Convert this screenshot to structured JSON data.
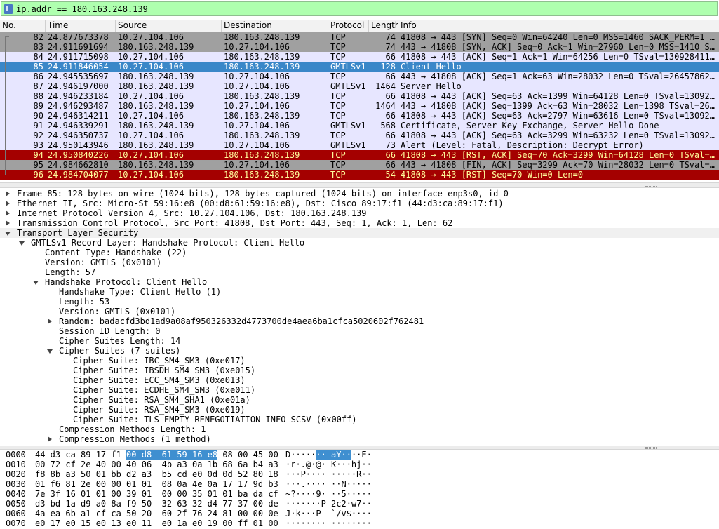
{
  "filter": {
    "value": "ip.addr == 180.163.248.139"
  },
  "columns": [
    "No.",
    "Time",
    "Source",
    "Destination",
    "Protocol",
    "Length",
    "Info"
  ],
  "packets": [
    {
      "no": "82",
      "time": "24.877673378",
      "src": "10.27.104.106",
      "dst": "180.163.248.139",
      "proto": "TCP",
      "len": "74",
      "info": "41808 → 443 [SYN] Seq=0 Win=64240 Len=0 MSS=1460 SACK_PERM=1 …",
      "bg": "#a0a0a0",
      "fg": "#000000"
    },
    {
      "no": "83",
      "time": "24.911691694",
      "src": "180.163.248.139",
      "dst": "10.27.104.106",
      "proto": "TCP",
      "len": "74",
      "info": "443 → 41808 [SYN, ACK] Seq=0 Ack=1 Win=27960 Len=0 MSS=1410 S…",
      "bg": "#a0a0a0",
      "fg": "#000000"
    },
    {
      "no": "84",
      "time": "24.911715098",
      "src": "10.27.104.106",
      "dst": "180.163.248.139",
      "proto": "TCP",
      "len": "66",
      "info": "41808 → 443 [ACK] Seq=1 Ack=1 Win=64256 Len=0 TSval=130928411…",
      "bg": "#e7e6ff",
      "fg": "#000000"
    },
    {
      "no": "85",
      "time": "24.911846054",
      "src": "10.27.104.106",
      "dst": "180.163.248.139",
      "proto": "GMTLSv1",
      "len": "128",
      "info": "Client Hello",
      "bg": "#3a87c8",
      "fg": "#ffffff"
    },
    {
      "no": "86",
      "time": "24.945535697",
      "src": "180.163.248.139",
      "dst": "10.27.104.106",
      "proto": "TCP",
      "len": "66",
      "info": "443 → 41808 [ACK] Seq=1 Ack=63 Win=28032 Len=0 TSval=26457862…",
      "bg": "#e7e6ff",
      "fg": "#000000"
    },
    {
      "no": "87",
      "time": "24.946197000",
      "src": "180.163.248.139",
      "dst": "10.27.104.106",
      "proto": "GMTLSv1",
      "len": "1464",
      "info": "Server Hello",
      "bg": "#e7e6ff",
      "fg": "#000000"
    },
    {
      "no": "88",
      "time": "24.946233184",
      "src": "10.27.104.106",
      "dst": "180.163.248.139",
      "proto": "TCP",
      "len": "66",
      "info": "41808 → 443 [ACK] Seq=63 Ack=1399 Win=64128 Len=0 TSval=13092…",
      "bg": "#e7e6ff",
      "fg": "#000000"
    },
    {
      "no": "89",
      "time": "24.946293487",
      "src": "180.163.248.139",
      "dst": "10.27.104.106",
      "proto": "TCP",
      "len": "1464",
      "info": "443 → 41808 [ACK] Seq=1399 Ack=63 Win=28032 Len=1398 TSval=26…",
      "bg": "#e7e6ff",
      "fg": "#000000"
    },
    {
      "no": "90",
      "time": "24.946314211",
      "src": "10.27.104.106",
      "dst": "180.163.248.139",
      "proto": "TCP",
      "len": "66",
      "info": "41808 → 443 [ACK] Seq=63 Ack=2797 Win=63616 Len=0 TSval=13092…",
      "bg": "#e7e6ff",
      "fg": "#000000"
    },
    {
      "no": "91",
      "time": "24.946339291",
      "src": "180.163.248.139",
      "dst": "10.27.104.106",
      "proto": "GMTLSv1",
      "len": "568",
      "info": "Certificate, Server Key Exchange, Server Hello Done",
      "bg": "#e7e6ff",
      "fg": "#000000"
    },
    {
      "no": "92",
      "time": "24.946350737",
      "src": "10.27.104.106",
      "dst": "180.163.248.139",
      "proto": "TCP",
      "len": "66",
      "info": "41808 → 443 [ACK] Seq=63 Ack=3299 Win=63232 Len=0 TSval=13092…",
      "bg": "#e7e6ff",
      "fg": "#000000"
    },
    {
      "no": "93",
      "time": "24.950143946",
      "src": "180.163.248.139",
      "dst": "10.27.104.106",
      "proto": "GMTLSv1",
      "len": "73",
      "info": "Alert (Level: Fatal, Description: Decrypt Error)",
      "bg": "#e7e6ff",
      "fg": "#000000"
    },
    {
      "no": "94",
      "time": "24.950840226",
      "src": "10.27.104.106",
      "dst": "180.163.248.139",
      "proto": "TCP",
      "len": "66",
      "info": "41808 → 443 [RST, ACK] Seq=70 Ack=3299 Win=64128 Len=0 TSval=…",
      "bg": "#a40000",
      "fg": "#fffc9c"
    },
    {
      "no": "95",
      "time": "24.984662810",
      "src": "180.163.248.139",
      "dst": "10.27.104.106",
      "proto": "TCP",
      "len": "66",
      "info": "443 → 41808 [FIN, ACK] Seq=3299 Ack=70 Win=28032 Len=0 TSval=…",
      "bg": "#a0a0a0",
      "fg": "#000000"
    },
    {
      "no": "96",
      "time": "24.984704077",
      "src": "10.27.104.106",
      "dst": "180.163.248.139",
      "proto": "TCP",
      "len": "54",
      "info": "41808 → 443 [RST] Seq=70 Win=0 Len=0",
      "bg": "#a40000",
      "fg": "#fffc9c"
    }
  ],
  "details": [
    {
      "indent": 0,
      "toggle": "collapsed",
      "text": "Frame 85: 128 bytes on wire (1024 bits), 128 bytes captured (1024 bits) on interface enp3s0, id 0"
    },
    {
      "indent": 0,
      "toggle": "collapsed",
      "text": "Ethernet II, Src: Micro-St_59:16:e8 (00:d8:61:59:16:e8), Dst: Cisco_89:17:f1 (44:d3:ca:89:17:f1)"
    },
    {
      "indent": 0,
      "toggle": "collapsed",
      "text": "Internet Protocol Version 4, Src: 10.27.104.106, Dst: 180.163.248.139"
    },
    {
      "indent": 0,
      "toggle": "collapsed",
      "text": "Transmission Control Protocol, Src Port: 41808, Dst Port: 443, Seq: 1, Ack: 1, Len: 62"
    },
    {
      "indent": 0,
      "toggle": "expanded",
      "text": "Transport Layer Security",
      "shaded": true
    },
    {
      "indent": 1,
      "toggle": "expanded",
      "text": "GMTLSv1 Record Layer: Handshake Protocol: Client Hello"
    },
    {
      "indent": 2,
      "toggle": "none",
      "text": "Content Type: Handshake (22)"
    },
    {
      "indent": 2,
      "toggle": "none",
      "text": "Version: GMTLS (0x0101)"
    },
    {
      "indent": 2,
      "toggle": "none",
      "text": "Length: 57"
    },
    {
      "indent": 2,
      "toggle": "expanded",
      "text": "Handshake Protocol: Client Hello"
    },
    {
      "indent": 3,
      "toggle": "none",
      "text": "Handshake Type: Client Hello (1)"
    },
    {
      "indent": 3,
      "toggle": "none",
      "text": "Length: 53"
    },
    {
      "indent": 3,
      "toggle": "none",
      "text": "Version: GMTLS (0x0101)"
    },
    {
      "indent": 3,
      "toggle": "collapsed",
      "text": "Random: badacfd3bd1ad9a08af950326332d4773700de4aea6ba1cfca5020602f762481"
    },
    {
      "indent": 3,
      "toggle": "none",
      "text": "Session ID Length: 0"
    },
    {
      "indent": 3,
      "toggle": "none",
      "text": "Cipher Suites Length: 14"
    },
    {
      "indent": 3,
      "toggle": "expanded",
      "text": "Cipher Suites (7 suites)"
    },
    {
      "indent": 4,
      "toggle": "none",
      "text": "Cipher Suite: IBC_SM4_SM3 (0xe017)"
    },
    {
      "indent": 4,
      "toggle": "none",
      "text": "Cipher Suite: IBSDH_SM4_SM3 (0xe015)"
    },
    {
      "indent": 4,
      "toggle": "none",
      "text": "Cipher Suite: ECC_SM4_SM3 (0xe013)"
    },
    {
      "indent": 4,
      "toggle": "none",
      "text": "Cipher Suite: ECDHE_SM4_SM3 (0xe011)"
    },
    {
      "indent": 4,
      "toggle": "none",
      "text": "Cipher Suite: RSA_SM4_SHA1 (0xe01a)"
    },
    {
      "indent": 4,
      "toggle": "none",
      "text": "Cipher Suite: RSA_SM4_SM3 (0xe019)"
    },
    {
      "indent": 4,
      "toggle": "none",
      "text": "Cipher Suite: TLS_EMPTY_RENEGOTIATION_INFO_SCSV (0x00ff)"
    },
    {
      "indent": 3,
      "toggle": "none",
      "text": "Compression Methods Length: 1"
    },
    {
      "indent": 3,
      "toggle": "collapsed",
      "text": "Compression Methods (1 method)"
    }
  ],
  "hex": [
    {
      "offset": "0000",
      "pre": "44 d3 ca 89 17 f1 ",
      "hl": "00 d8  61 59 16 e8",
      "post": " 08 00 45 00",
      "apre": "D·····",
      "ahl": "·· aY··",
      "apost": "··E·"
    },
    {
      "offset": "0010",
      "pre": "00 72 cf 2e 40 00 40 06  4b a3 0a 1b 68 6a b4 a3",
      "hl": "",
      "post": "",
      "apre": "·r·.@·@· K···hj··",
      "ahl": "",
      "apost": ""
    },
    {
      "offset": "0020",
      "pre": "f8 8b a3 50 01 bb d2 a3  b5 cd e0 0d 0d 52 80 18",
      "hl": "",
      "post": "",
      "apre": "···P···· ·····R··",
      "ahl": "",
      "apost": ""
    },
    {
      "offset": "0030",
      "pre": "01 f6 81 2e 00 00 01 01  08 0a 4e 0a 17 17 9d b3",
      "hl": "",
      "post": "",
      "apre": "···.···· ··N·····",
      "ahl": "",
      "apost": ""
    },
    {
      "offset": "0040",
      "pre": "7e 3f 16 01 01 00 39 01  00 00 35 01 01 ba da cf",
      "hl": "",
      "post": "",
      "apre": "~?····9· ··5·····",
      "ahl": "",
      "apost": ""
    },
    {
      "offset": "0050",
      "pre": "d3 bd 1a d9 a0 8a f9 50  32 63 32 d4 77 37 00 de",
      "hl": "",
      "post": "",
      "apre": "·······P 2c2·w7··",
      "ahl": "",
      "apost": ""
    },
    {
      "offset": "0060",
      "pre": "4a ea 6b a1 cf ca 50 20  60 2f 76 24 81 00 00 0e",
      "hl": "",
      "post": "",
      "apre": "J·k···P  `/v$····",
      "ahl": "",
      "apost": ""
    },
    {
      "offset": "0070",
      "pre": "e0 17 e0 15 e0 13 e0 11  e0 1a e0 19 00 ff 01 00",
      "hl": "",
      "post": "",
      "apre": "········ ········",
      "ahl": "",
      "apost": ""
    }
  ]
}
